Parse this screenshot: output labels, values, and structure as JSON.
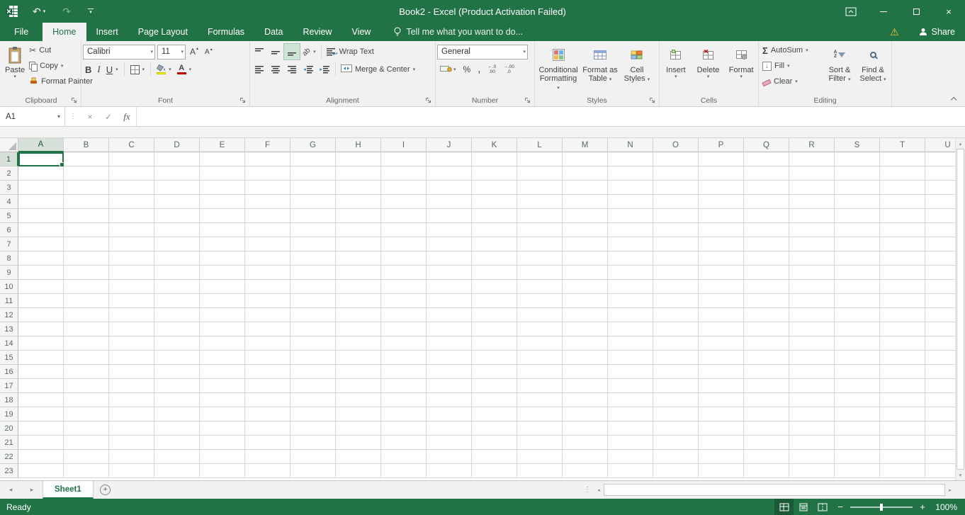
{
  "titlebar": {
    "title": "Book2 - Excel (Product Activation Failed)"
  },
  "tabrow": {
    "file": "File",
    "tabs": [
      "Home",
      "Insert",
      "Page Layout",
      "Formulas",
      "Data",
      "Review",
      "View"
    ],
    "tell_me": "Tell me what you want to do...",
    "share": "Share"
  },
  "ribbon": {
    "clipboard": {
      "label": "Clipboard",
      "paste": "Paste",
      "cut": "Cut",
      "copy": "Copy",
      "format_painter": "Format Painter"
    },
    "font": {
      "label": "Font",
      "family": "Calibri",
      "size": "11",
      "bold": "B",
      "italic": "I",
      "underline": "U"
    },
    "alignment": {
      "label": "Alignment",
      "wrap_text": "Wrap Text",
      "merge_center": "Merge & Center",
      "orientation": "ab"
    },
    "number": {
      "label": "Number",
      "format": "General",
      "percent": "%",
      "comma": ",",
      "increase_decimal": "←.0\n.00",
      "decrease_decimal": "→.00\n.0"
    },
    "styles": {
      "label": "Styles",
      "conditional_formatting": "Conditional Formatting",
      "format_as_table": "Format as Table",
      "cell_styles": "Cell Styles"
    },
    "cells": {
      "label": "Cells",
      "insert": "Insert",
      "delete": "Delete",
      "format": "Format"
    },
    "editing": {
      "label": "Editing",
      "autosum": "AutoSum",
      "fill": "Fill",
      "clear": "Clear",
      "sort_filter": "Sort & Filter",
      "find_select": "Find & Select"
    }
  },
  "formula_bar": {
    "name_box": "A1",
    "fx": "fx"
  },
  "grid": {
    "columns": [
      "A",
      "B",
      "C",
      "D",
      "E",
      "F",
      "G",
      "H",
      "I",
      "J",
      "K",
      "L",
      "M",
      "N",
      "O",
      "P",
      "Q",
      "R",
      "S",
      "T",
      "U"
    ],
    "row_count": 23,
    "selected_cell": "A1",
    "selected_column": "A",
    "selected_row": "1"
  },
  "sheet_bar": {
    "sheet": "Sheet1"
  },
  "status_bar": {
    "mode": "Ready",
    "zoom": "100%"
  },
  "icons": {
    "undo": "↶",
    "redo": "↷",
    "dropdown": "▾",
    "up": "▴",
    "down": "▾",
    "left": "◂",
    "right": "▸",
    "warning": "⚠",
    "close": "×",
    "check": "✓",
    "cancel": "×",
    "cut": "✂",
    "sigma": "Σ",
    "vdots": "⋮",
    "wrap": "↩",
    "fill_down": "↓",
    "grow": "A",
    "shrink": "A",
    "font_color_letter": "A",
    "sort_a": "A",
    "sort_z": "Z",
    "minus": "−",
    "plus": "+"
  }
}
